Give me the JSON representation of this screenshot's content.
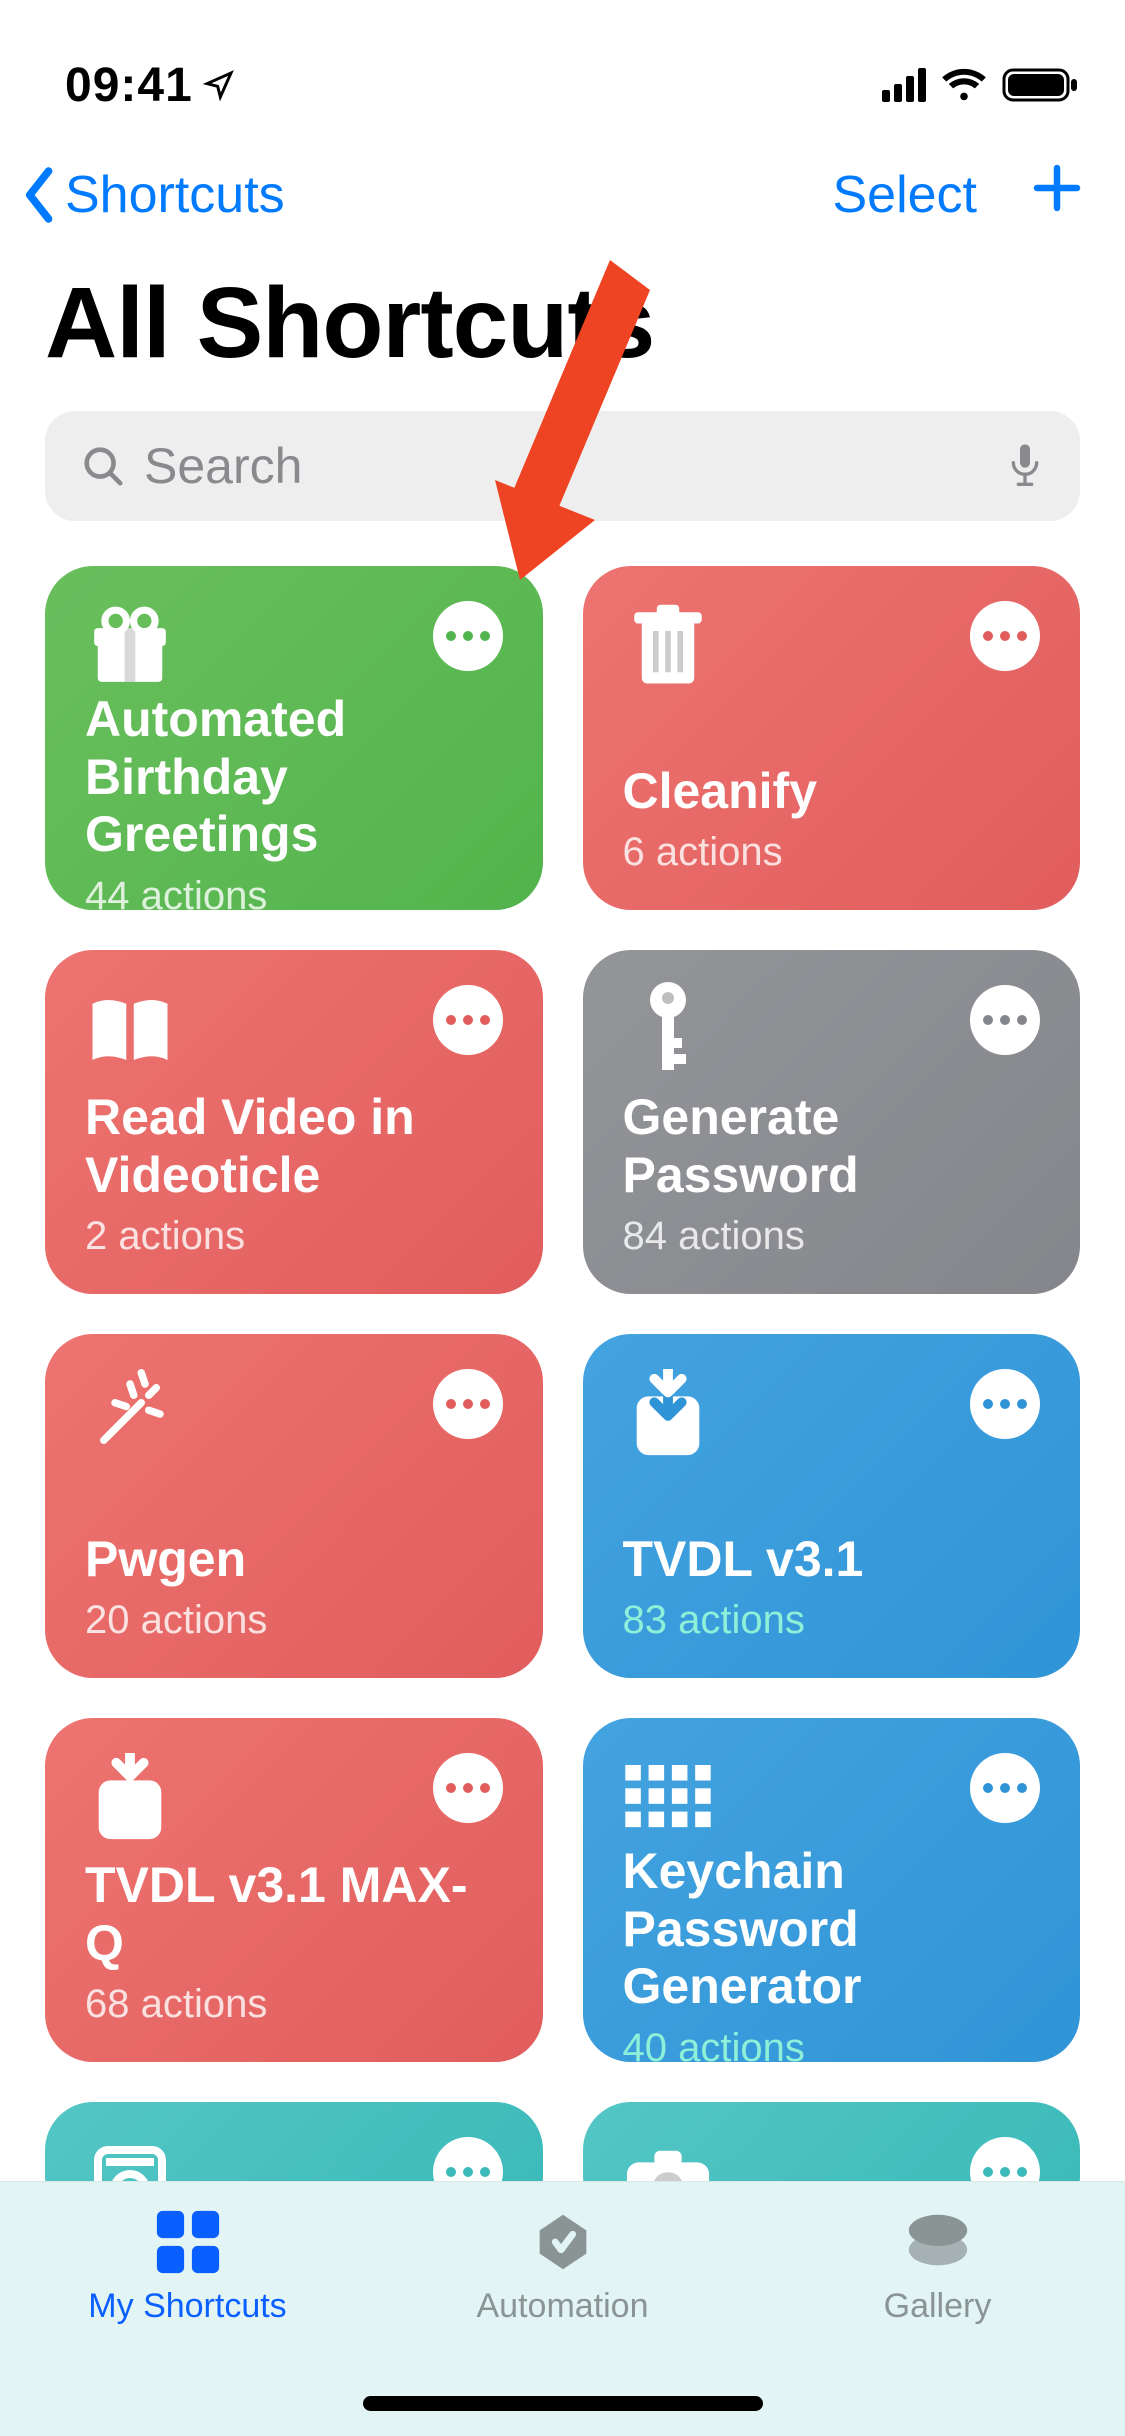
{
  "status": {
    "time": "09:41"
  },
  "nav": {
    "back_label": "Shortcuts",
    "select_label": "Select"
  },
  "title": "All Shortcuts",
  "search": {
    "placeholder": "Search"
  },
  "tiles": [
    {
      "title": "Automated Birthday Greetings",
      "sub": "44 actions",
      "color": "green",
      "icon": "gift",
      "sub_class": "sub-dim"
    },
    {
      "title": "Cleanify",
      "sub": "6 actions",
      "color": "red",
      "icon": "trash",
      "sub_class": "sub-dim"
    },
    {
      "title": "Read Video in Videoticle",
      "sub": "2 actions",
      "color": "red",
      "icon": "book",
      "sub_class": "sub-dim"
    },
    {
      "title": "Generate Password",
      "sub": "84 actions",
      "color": "gray",
      "icon": "key",
      "sub_class": "sub-dim"
    },
    {
      "title": "Pwgen",
      "sub": "20 actions",
      "color": "red",
      "icon": "wand",
      "sub_class": "sub-dim"
    },
    {
      "title": "TVDL v3.1",
      "sub": "83 actions",
      "color": "blue",
      "icon": "download",
      "sub_class": "sub-teal"
    },
    {
      "title": "TVDL v3.1 MAX-Q",
      "sub": "68 actions",
      "color": "red",
      "icon": "download",
      "sub_class": "sub-dim"
    },
    {
      "title": "Keychain Password Generator",
      "sub": "40 actions",
      "color": "blue",
      "icon": "grid",
      "sub_class": "sub-teal"
    },
    {
      "title": "",
      "sub": "",
      "color": "teal",
      "icon": "washer",
      "sub_class": ""
    },
    {
      "title": "",
      "sub": "",
      "color": "teal",
      "icon": "camera",
      "sub_class": ""
    }
  ],
  "tabs": {
    "my_shortcuts": "My Shortcuts",
    "automation": "Automation",
    "gallery": "Gallery"
  }
}
